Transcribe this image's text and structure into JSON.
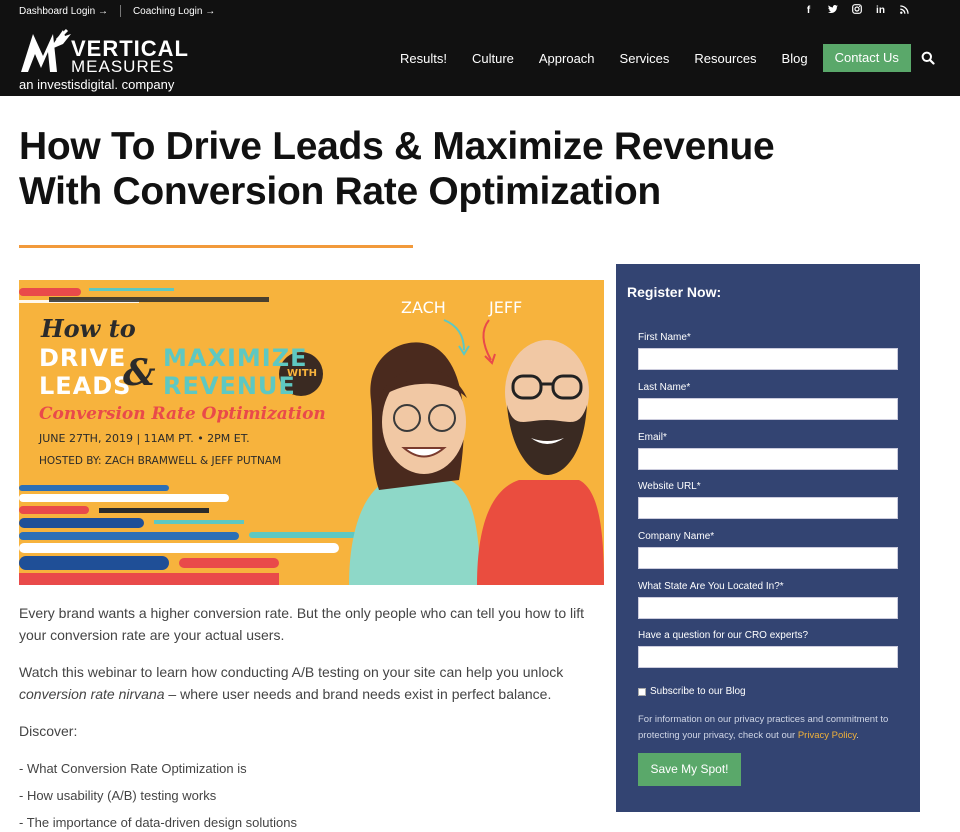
{
  "topbar": {
    "dashboard_login": "Dashboard Login →",
    "coaching_login": "Coaching Login →",
    "socials": [
      "f",
      "t",
      "ig",
      "in",
      "rss"
    ]
  },
  "logo": {
    "line1": "VERTICAL",
    "line2": "MEASURES",
    "tagline": "an investisdigital. company"
  },
  "nav": {
    "items": [
      "Results!",
      "Culture",
      "Approach",
      "Services",
      "Resources",
      "Blog"
    ],
    "contact_label": "Contact Us",
    "search_icon": "search-icon"
  },
  "article": {
    "title_line1": "How To Drive Leads & Maximize Revenue",
    "title_line2": "With Conversion Rate Optimization",
    "accent_color": "#f29a3b",
    "hero": {
      "how_to": "How to",
      "drive": "DRIVE",
      "leads": "LEADS",
      "amp": "&",
      "maximize": "MAXIMIZE",
      "revenue": "REVENUE",
      "with": "WITH",
      "cro": "Conversion Rate Optimization",
      "date": "JUNE 27TH, 2019 | 11AM PT. • 2PM ET.",
      "hosted": "HOSTED BY: ZACH BRAMWELL & JEFF PUTNAM",
      "name_zach": "ZACH",
      "name_jeff": "JEFF"
    },
    "para1": "Every brand wants a higher conversion rate. But the only people who can tell you how to lift your conversion rate are your actual users.",
    "para2_a": "Watch this webinar to learn how conducting A/B testing on your site can help you unlock ",
    "para2_em": "conversion rate nirvana",
    "para2_b": " – where user needs and brand needs exist in perfect balance.",
    "discover_label": "Discover:",
    "bullets": [
      "-  What Conversion Rate Optimization is",
      "-  How usability (A/B) testing works",
      "-  The importance of data-driven design solutions"
    ]
  },
  "form": {
    "heading": "Register Now:",
    "fields": [
      {
        "label": "First Name*",
        "value": ""
      },
      {
        "label": "Last Name*",
        "value": ""
      },
      {
        "label": "Email*",
        "value": ""
      },
      {
        "label": "Website URL*",
        "value": ""
      },
      {
        "label": "Company Name*",
        "value": ""
      },
      {
        "label": "What State Are You Located In?*",
        "value": ""
      },
      {
        "label": "Have a question for our CRO experts?",
        "value": ""
      }
    ],
    "subscribe_label": "Subscribe to our Blog",
    "privacy_text": "For information on our privacy practices and commitment to protecting your privacy, check out our ",
    "privacy_link": "Privacy Policy",
    "privacy_end": ".",
    "submit_label": "Save My Spot!",
    "panel_color": "#334472",
    "button_color": "#5aa86a"
  }
}
